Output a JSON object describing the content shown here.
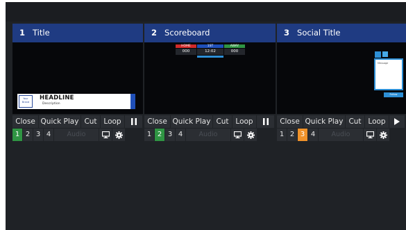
{
  "panels": [
    {
      "number": "1",
      "title": "Title",
      "controls": [
        "Close",
        "Quick Play",
        "Cut",
        "Loop"
      ],
      "play_state_icon": "pause-icon",
      "inputs": [
        "1",
        "2",
        "3",
        "4"
      ],
      "active_input": "1",
      "active_color": "#2f9443",
      "audio_label": "Audio",
      "preview": {
        "logo_text": "Your Brand",
        "headline": "HEADLINE",
        "description": "Description"
      }
    },
    {
      "number": "2",
      "title": "Scoreboard",
      "controls": [
        "Close",
        "Quick Play",
        "Cut",
        "Loop"
      ],
      "play_state_icon": "pause-icon",
      "inputs": [
        "1",
        "2",
        "3",
        "4"
      ],
      "active_input": "2",
      "active_color": "#2f9443",
      "audio_label": "Audio",
      "preview": {
        "home_label": "HOME",
        "period_label": "1ST",
        "away_label": "AWAY",
        "home_score": "000",
        "clock": "12:02",
        "away_score": "000"
      }
    },
    {
      "number": "3",
      "title": "Social Title",
      "controls": [
        "Close",
        "Quick Play",
        "Cut",
        "Loop"
      ],
      "play_state_icon": "play-icon",
      "inputs": [
        "1",
        "2",
        "3",
        "4"
      ],
      "active_input": "3",
      "active_color": "#f0922a",
      "audio_label": "Audio",
      "preview": {
        "name_text": "Message",
        "button_text": "Follow"
      }
    }
  ]
}
